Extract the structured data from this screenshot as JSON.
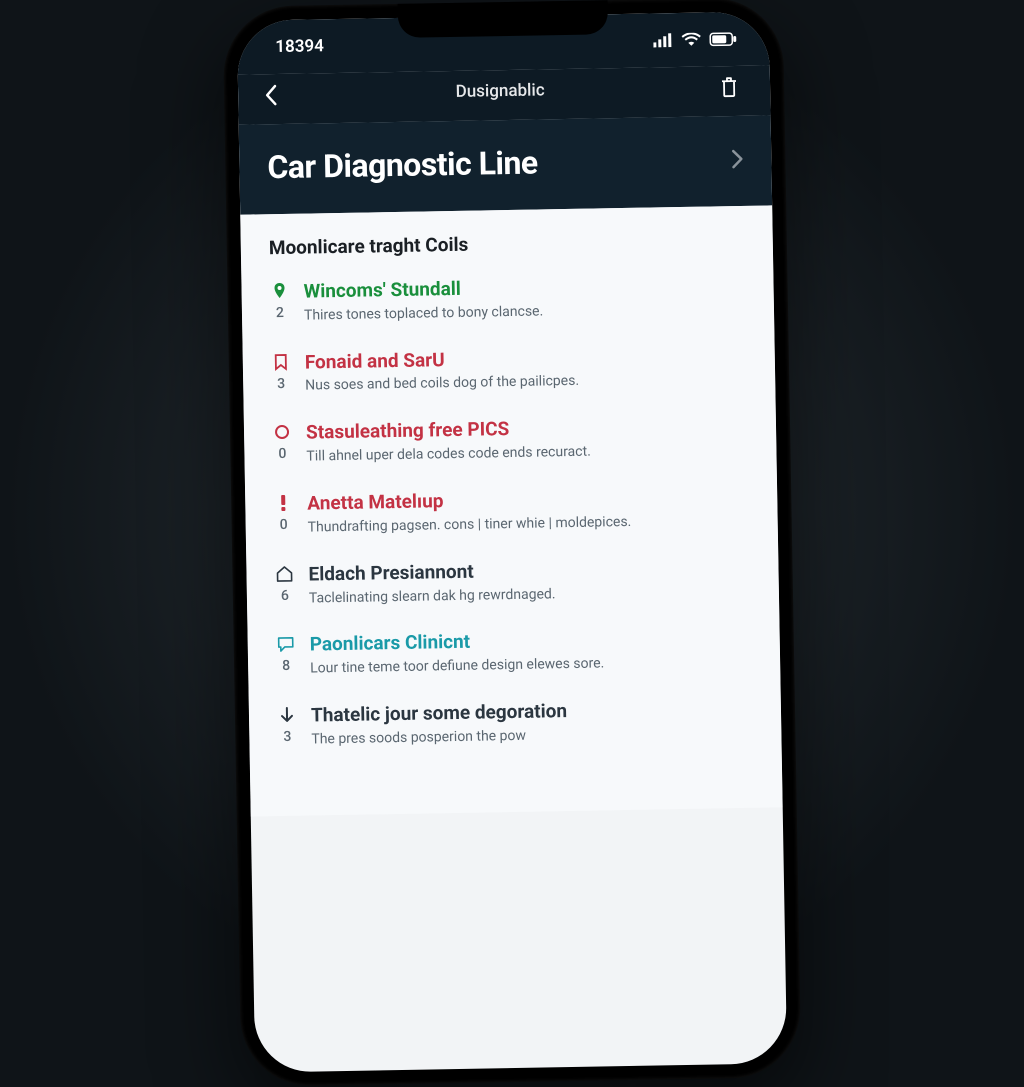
{
  "status": {
    "time": "18394"
  },
  "header": {
    "small_title": "Dusignablic",
    "big_title": "Car Diagnostic Line"
  },
  "section_label": "Moonlicare traght Coils",
  "items": [
    {
      "num": "2",
      "icon": "pin-down-icon",
      "title": "Wincoms' Stundall",
      "title_class": "c-green",
      "desc": "Thires tones toplaced to bony clancse."
    },
    {
      "num": "3",
      "icon": "bookmark-icon",
      "title": "Fonaid and SarU",
      "title_class": "c-red",
      "desc": "Nus soes and bed coils dog of the pailicpes."
    },
    {
      "num": "0",
      "icon": "circle-icon",
      "title": "Stasuleathing free PICS",
      "title_class": "c-red",
      "desc": "Till ahnel uper dela codes code ends recuract."
    },
    {
      "num": "0",
      "icon": "warning-icon",
      "title": "Anetta Matelıup",
      "title_class": "c-red",
      "desc": "Thundrafting pagsen. cons | tiner whie | moldepices."
    },
    {
      "num": "6",
      "icon": "house-icon",
      "title": "Eldach Presiannont",
      "title_class": "c-grey",
      "desc": "Taclelinating slearn dak hg rewrdnaged."
    },
    {
      "num": "8",
      "icon": "chat-icon",
      "title": "Paonlicars Clinicnt",
      "title_class": "c-teal",
      "desc": "Lour tine teme toor defiune design elewes sore."
    },
    {
      "num": "3",
      "icon": "down-arrow-icon",
      "title": "Thatelic jour some degoration",
      "title_class": "c-grey",
      "desc": "The pres soods posperion the pow"
    }
  ]
}
